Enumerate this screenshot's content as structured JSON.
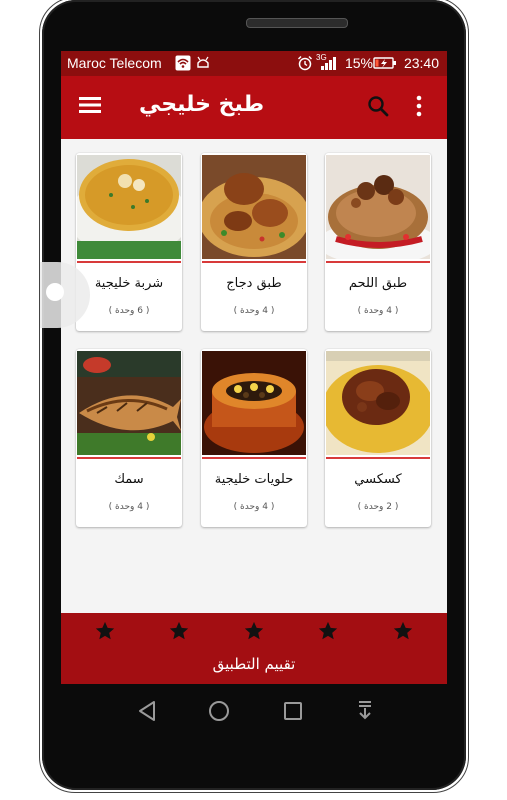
{
  "status_bar": {
    "carrier": "Maroc Telecom",
    "network": "3G",
    "battery_percent": "15%",
    "time": "23:40"
  },
  "app_bar": {
    "title": "طبخ خليجي",
    "icons": [
      "menu-icon",
      "search-icon",
      "more-vert-icon"
    ]
  },
  "categories": [
    {
      "name": "طبق اللحم",
      "count": "( 4 وحدة )",
      "image": "meat-rice-dish"
    },
    {
      "name": "طبق دجاج",
      "count": "( 4 وحدة )",
      "image": "chicken-rice-dish"
    },
    {
      "name": "شربة خليجية",
      "count": "( 6 وحدة )",
      "image": "soup-bowl"
    },
    {
      "name": "كسكسي",
      "count": "( 2 وحدة )",
      "image": "couscous-dish"
    },
    {
      "name": "حلويات خليجية",
      "count": "( 4 وحدة )",
      "image": "gulf-sweets"
    },
    {
      "name": "سمك",
      "count": "( 4 وحدة )",
      "image": "grilled-fish"
    }
  ],
  "rating": {
    "stars": 5,
    "label": "تقييم التطبيق"
  },
  "colors": {
    "status_bar": "#8c0e0e",
    "app_bar": "#b70d13",
    "rating_bar": "#a30e12",
    "card_rule": "#d83a3a"
  },
  "system_nav": [
    "back-icon",
    "home-icon",
    "recents-icon",
    "notification-pull-icon"
  ]
}
